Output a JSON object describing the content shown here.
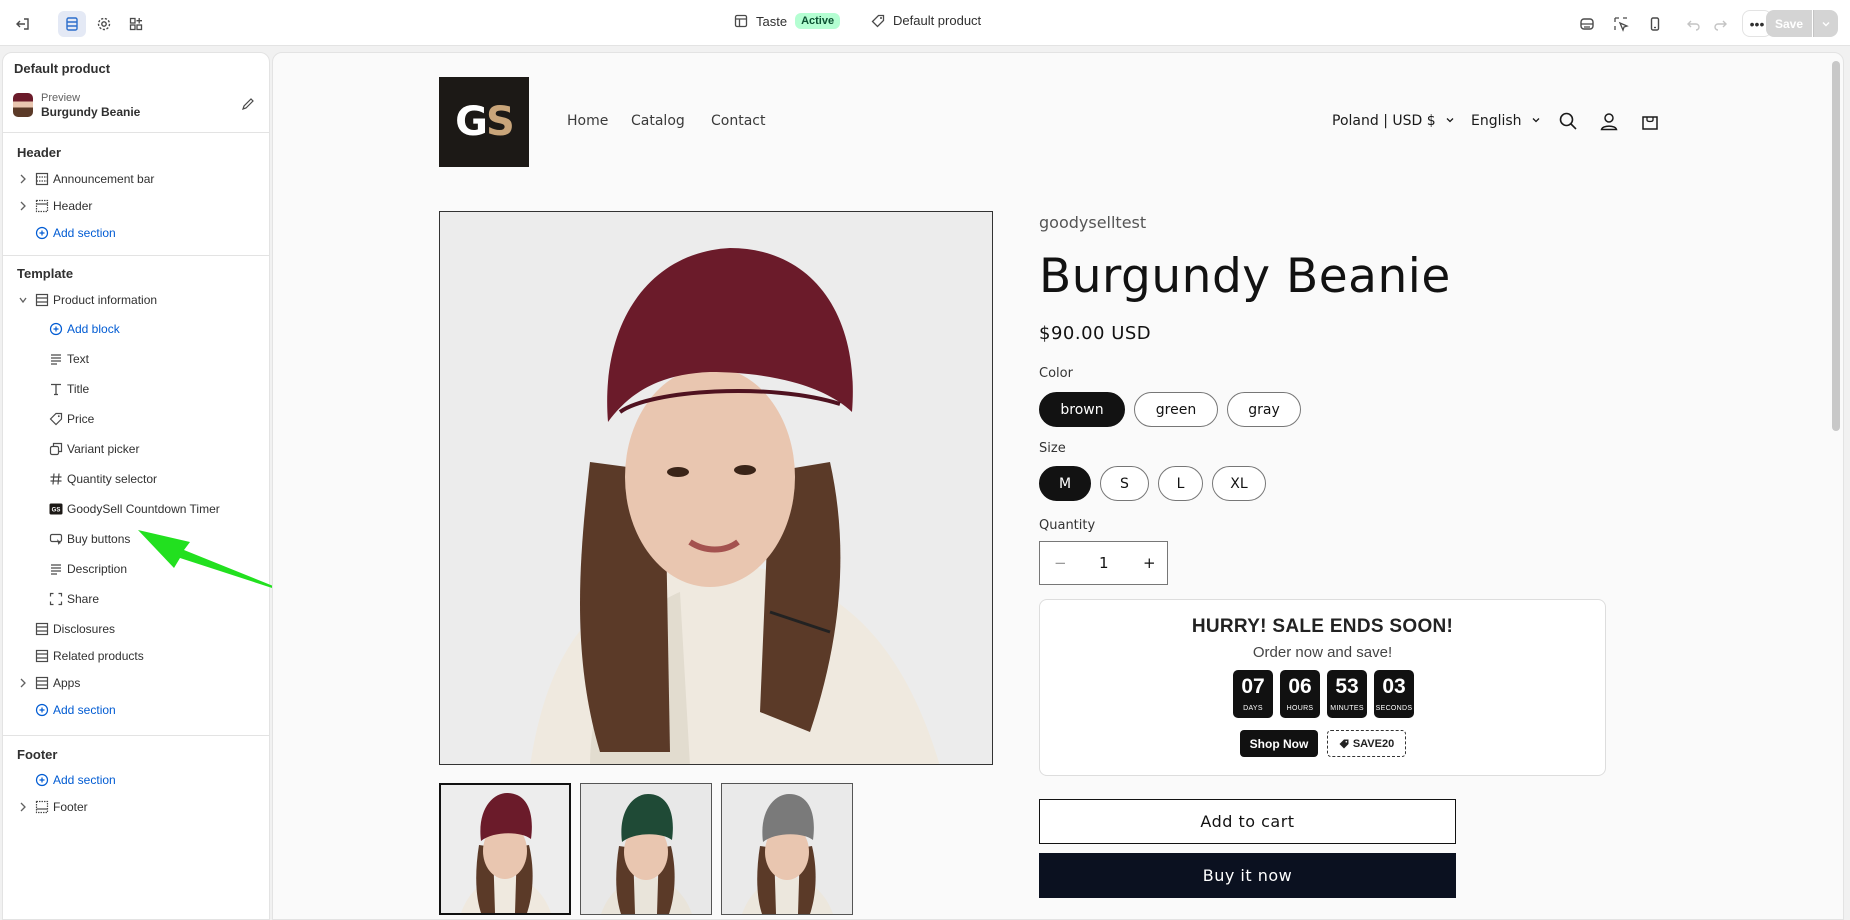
{
  "topbar": {
    "theme_name": "Taste",
    "theme_status": "Active",
    "template_name": "Default product",
    "save_label": "Save"
  },
  "sidebar": {
    "title": "Default product",
    "preview_label": "Preview",
    "preview_product": "Burgundy Beanie",
    "header_heading": "Header",
    "header_items": [
      "Announcement bar",
      "Header"
    ],
    "add_section": "Add section",
    "template_heading": "Template",
    "product_information": "Product information",
    "add_block": "Add block",
    "blocks": [
      "Text",
      "Title",
      "Price",
      "Variant picker",
      "Quantity selector",
      "GoodySell Countdown Timer",
      "Buy buttons",
      "Description",
      "Share"
    ],
    "template_sections": [
      "Disclosures",
      "Related products",
      "Apps"
    ],
    "footer_heading": "Footer",
    "footer_items": [
      "Footer"
    ]
  },
  "store": {
    "logo_g": "G",
    "logo_s": "S",
    "nav": [
      "Home",
      "Catalog",
      "Contact"
    ],
    "country": "Poland | USD $",
    "language": "English"
  },
  "product": {
    "vendor": "goodyselltest",
    "title": "Burgundy Beanie",
    "price": "$90.00 USD",
    "color_label": "Color",
    "colors": [
      "brown",
      "green",
      "gray"
    ],
    "size_label": "Size",
    "sizes": [
      "M",
      "S",
      "L",
      "XL"
    ],
    "quantity_label": "Quantity",
    "quantity": "1",
    "minus": "−",
    "plus": "+",
    "add_to_cart": "Add to cart",
    "buy_now": "Buy it now"
  },
  "timer": {
    "title": "HURRY! SALE ENDS SOON!",
    "subtitle": "Order now and save!",
    "cells": [
      {
        "num": "07",
        "unit": "DAYS"
      },
      {
        "num": "06",
        "unit": "HOURS"
      },
      {
        "num": "53",
        "unit": "MINUTES"
      },
      {
        "num": "03",
        "unit": "SECONDS"
      }
    ],
    "shop_now": "Shop Now",
    "coupon": "SAVE20"
  },
  "colors": {
    "accent_blue": "#005bd3",
    "badge_green": "#b4fed2",
    "arrow_green": "#22e01f",
    "beanie_burgundy": "#6b1b2a",
    "beanie_green": "#1f4a36",
    "beanie_gray": "#7a7a7a"
  }
}
